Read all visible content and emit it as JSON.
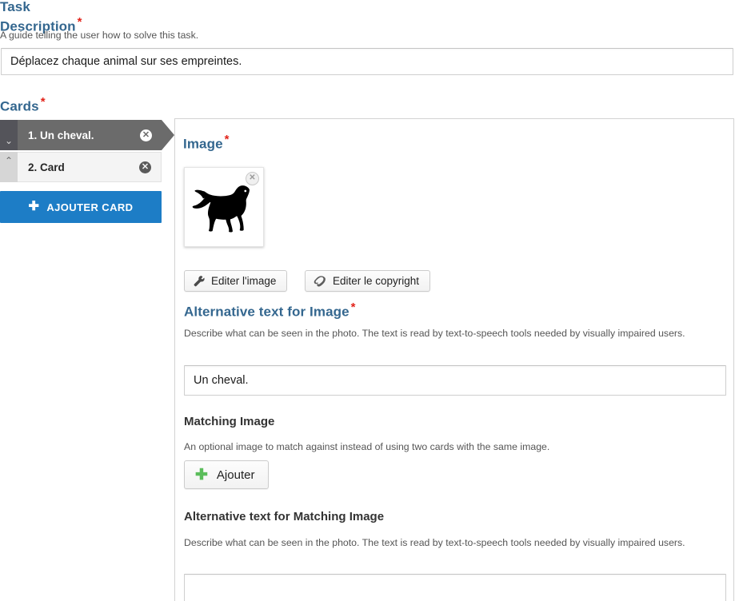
{
  "task_description": {
    "title": "Task Description",
    "required_marker": "*",
    "help_text": "A guide telling the user how to solve this task.",
    "value": "Déplacez chaque animal sur ses empreintes.",
    "placeholder": ""
  },
  "cards_panel": {
    "title": "Cards",
    "required_marker": "*",
    "items": [
      {
        "label": "1. Un cheval.",
        "selected": true,
        "toggle_icon": "chevron-down-icon",
        "toggle_glyph": "⌄",
        "delete_icon": "close-circle-icon",
        "delete_glyph": "✕"
      },
      {
        "label": "2. Card",
        "selected": false,
        "toggle_icon": "chevron-up-icon",
        "toggle_glyph": "⌃",
        "delete_icon": "close-circle-icon",
        "delete_glyph": "✕"
      }
    ],
    "add_button": {
      "label": "AJOUTER CARD",
      "icon": "plus-icon",
      "glyph": "✚",
      "color": "#1d7dc6"
    }
  },
  "card_editor": {
    "image_section": {
      "title": "Image",
      "required_marker": "*",
      "thumbnail_alt": "horse-silhouette",
      "remove_icon": "close-circle-icon",
      "remove_glyph": "✕",
      "edit_image_button": {
        "label": "Editer l'image",
        "icon": "wrench-icon"
      },
      "edit_copyright_button": {
        "label": "Editer le copyright",
        "icon": "copyright-icon"
      }
    },
    "alt_text_section": {
      "title": "Alternative text for Image",
      "required_marker": "*",
      "help_text": "Describe what can be seen in the photo. The text is read by text-to-speech tools needed by visually impaired users.",
      "value": "Un cheval.",
      "placeholder": ""
    },
    "matching_image_section": {
      "title": "Matching Image",
      "help_text": "An optional image to match against instead of using two cards with the same image.",
      "add_button": {
        "label": "Ajouter",
        "icon": "plus-icon",
        "glyph": "✚",
        "color": "#5bbd5b"
      }
    },
    "alt_matching_section": {
      "title": "Alternative text for Matching Image",
      "help_text": "Describe what can be seen in the photo. The text is read by text-to-speech tools needed by visually impaired users.",
      "value": "",
      "placeholder": ""
    }
  },
  "theme": {
    "heading_blue": "#34678f",
    "required_red": "#e2231a",
    "primary_blue": "#1d7dc6",
    "accent_green": "#5bbd5b",
    "selected_card_gray": "#6b6b6b"
  }
}
